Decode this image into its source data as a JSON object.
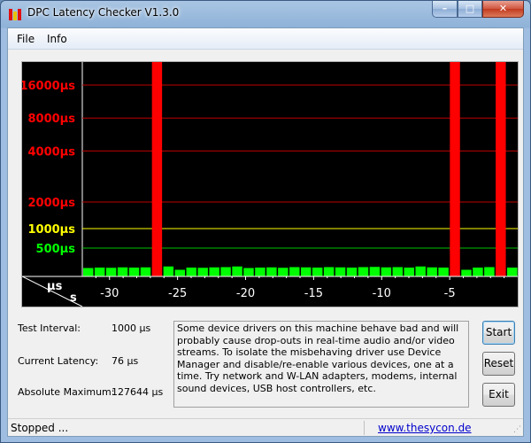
{
  "window": {
    "title": "DPC Latency Checker V1.3.0",
    "controls": {
      "minimize": "–",
      "maximize": "□",
      "close": "✕"
    }
  },
  "menu": {
    "file": "File",
    "info": "Info"
  },
  "chart_data": {
    "type": "bar",
    "y_labels": [
      {
        "text": "16000µs",
        "value": 16000,
        "color": "#ff0000"
      },
      {
        "text": "8000µs",
        "value": 8000,
        "color": "#ff0000"
      },
      {
        "text": "4000µs",
        "value": 4000,
        "color": "#ff0000"
      },
      {
        "text": "2000µs",
        "value": 2000,
        "color": "#ff0000"
      },
      {
        "text": "1000µs",
        "value": 1000,
        "color": "#ffff00"
      },
      {
        "text": "500µs",
        "value": 500,
        "color": "#00ff00"
      }
    ],
    "y_unit_label": "µs",
    "x_unit_label": "s",
    "x_ticks": [
      "-30",
      "-25",
      "-20",
      "-15",
      "-10",
      "-5"
    ],
    "x_tick_values": [
      -30,
      -25,
      -20,
      -15,
      -10,
      -5
    ],
    "x_range": [
      -32,
      0
    ],
    "grid": true,
    "bars_us": [
      76,
      80,
      78,
      82,
      80,
      82,
      130000,
      90,
      60,
      80,
      78,
      82,
      84,
      90,
      76,
      80,
      82,
      78,
      84,
      82,
      80,
      84,
      82,
      80,
      84,
      86,
      82,
      84,
      80,
      90,
      82,
      80,
      127644,
      60,
      80,
      84,
      127644,
      80
    ],
    "colors": {
      "normal": "#00ff00",
      "high": "#ff0000",
      "gridline_red": "#c00000",
      "gridline_yellow": "#ffff00",
      "gridline_green": "#00c000"
    }
  },
  "stats": {
    "test_interval_label": "Test Interval:",
    "test_interval_value": "1000 µs",
    "current_latency_label": "Current Latency:",
    "current_latency_value": "76 µs",
    "absolute_max_label": "Absolute Maximum:",
    "absolute_max_value": "127644 µs"
  },
  "description": "Some device drivers on this machine behave bad and will probably cause drop-outs in real-time audio and/or video streams. To isolate the misbehaving driver use Device Manager and disable/re-enable various devices, one at a time. Try network and W-LAN adapters, modems, internal sound devices, USB host controllers, etc.",
  "buttons": {
    "start": "Start",
    "reset": "Reset",
    "exit": "Exit"
  },
  "status": {
    "text": "Stopped ...",
    "link": "www.thesycon.de"
  }
}
